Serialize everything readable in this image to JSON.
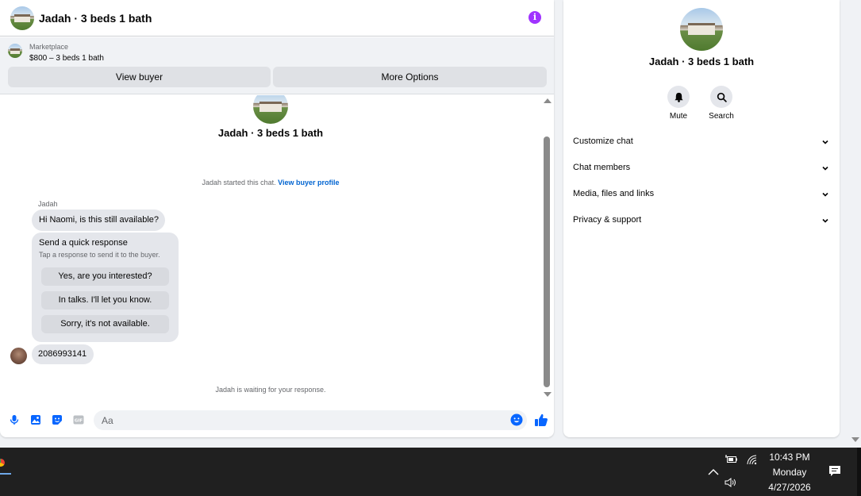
{
  "header": {
    "title": "Jadah · 3 beds 1 bath"
  },
  "listing": {
    "category": "Marketplace",
    "price_title": "$800 – 3 beds 1 bath",
    "view_buyer_label": "View buyer",
    "more_options_label": "More Options"
  },
  "messages": {
    "chat_name": "Jadah · 3 beds 1 bath",
    "started_text": "Jadah started this chat.",
    "view_profile_link": "View buyer profile",
    "sender_name": "Jadah",
    "first_message": "Hi Naomi, is this still available?",
    "quick_response_title": "Send a quick response",
    "quick_response_subtitle": "Tap a response to send it to the buyer.",
    "quick_responses": [
      "Yes, are you interested?",
      "In talks. I'll let you know.",
      "Sorry, it's not available."
    ],
    "second_message": "2086993141",
    "waiting_text": "Jadah is waiting for your response."
  },
  "composer": {
    "placeholder": "Aa"
  },
  "panel": {
    "name": "Jadah · 3 beds 1 bath",
    "mute_label": "Mute",
    "search_label": "Search",
    "sections": [
      "Customize chat",
      "Chat members",
      "Media, files and links",
      "Privacy & support"
    ]
  },
  "taskbar": {
    "time": "10:43 PM",
    "day": "Monday",
    "date": "4/27/2026"
  },
  "colors": {
    "accent": "#0866ff",
    "info": "#a033ff",
    "link": "#0064d1",
    "taskbar": "#202020"
  }
}
